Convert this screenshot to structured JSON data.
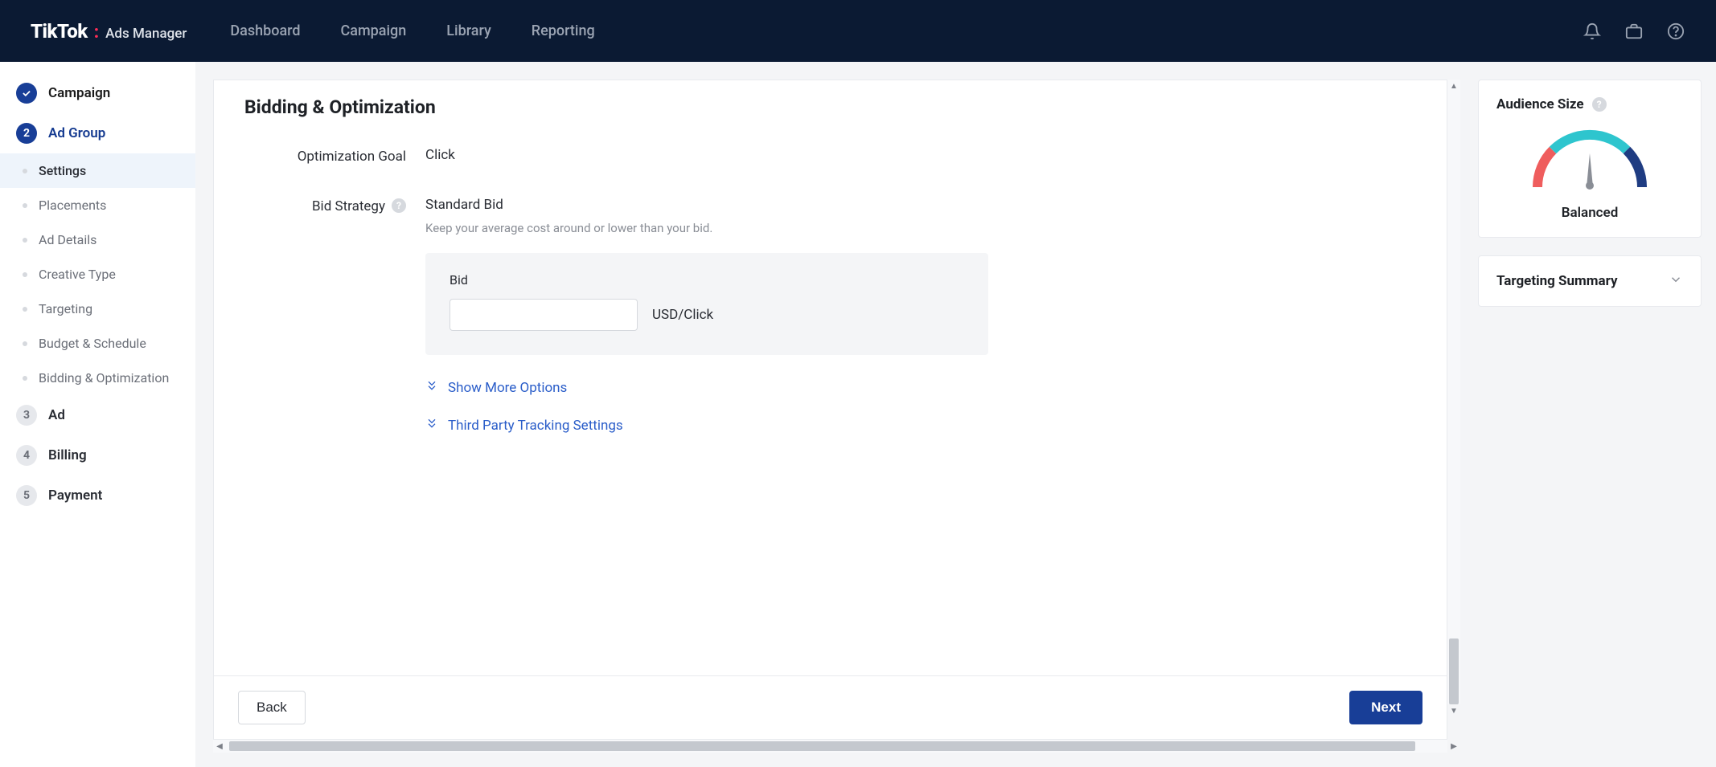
{
  "brand": {
    "name": "TikTok",
    "suffix": "Ads Manager"
  },
  "nav": {
    "dashboard": "Dashboard",
    "campaign": "Campaign",
    "library": "Library",
    "reporting": "Reporting"
  },
  "steps": {
    "campaign": {
      "label": "Campaign"
    },
    "adgroup": {
      "num": "2",
      "label": "Ad Group"
    },
    "subs": {
      "settings": "Settings",
      "placements": "Placements",
      "addetails": "Ad Details",
      "creative": "Creative Type",
      "targeting": "Targeting",
      "budget": "Budget & Schedule",
      "bidding": "Bidding & Optimization"
    },
    "ad": {
      "num": "3",
      "label": "Ad"
    },
    "billing": {
      "num": "4",
      "label": "Billing"
    },
    "payment": {
      "num": "5",
      "label": "Payment"
    }
  },
  "section": {
    "title": "Bidding & Optimization",
    "optgoal_label": "Optimization Goal",
    "optgoal_value": "Click",
    "bidstrategy_label": "Bid Strategy",
    "bidstrategy_value": "Standard Bid",
    "bidstrategy_hint": "Keep your average cost around or lower than your bid.",
    "bid_label": "Bid",
    "bid_unit": "USD/Click",
    "showmore": "Show More Options",
    "thirdparty": "Third Party Tracking Settings"
  },
  "footer": {
    "back": "Back",
    "next": "Next"
  },
  "right": {
    "audience_title": "Audience Size",
    "gauge_label": "Balanced",
    "summary_title": "Targeting Summary"
  }
}
